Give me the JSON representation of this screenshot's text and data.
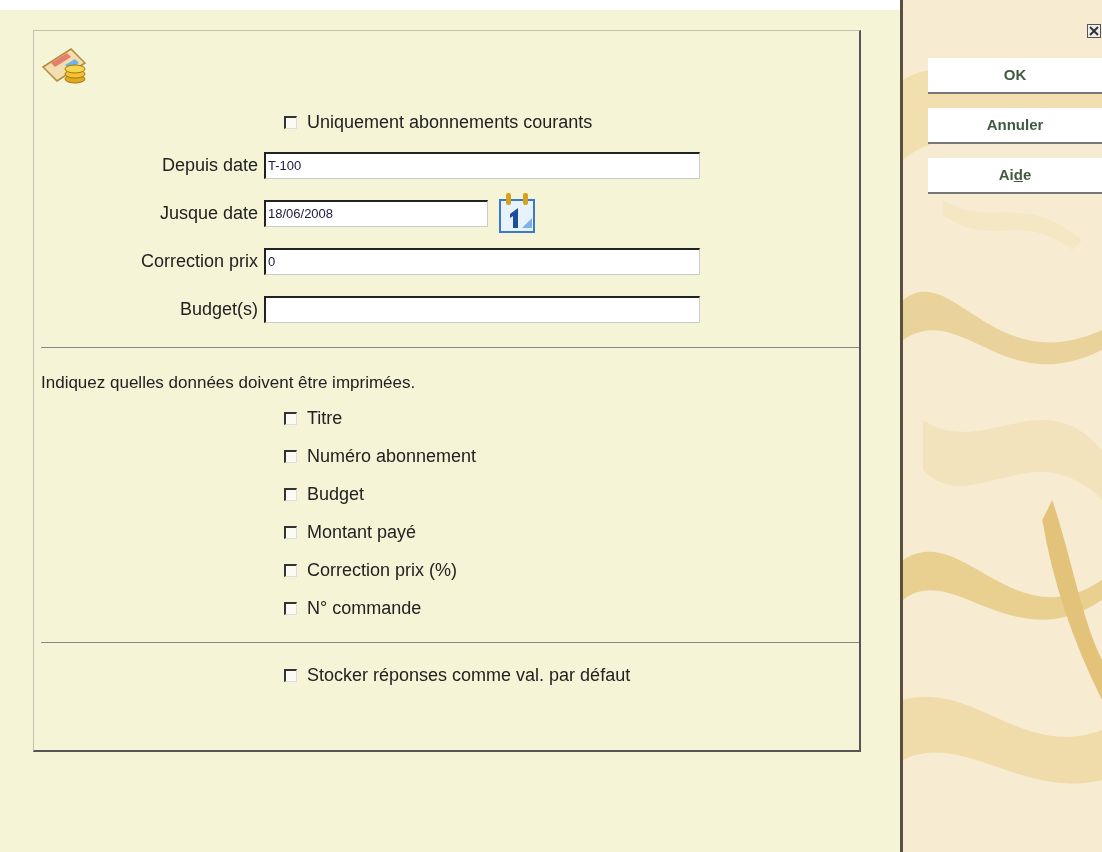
{
  "form": {
    "current_only": {
      "label": "Uniquement abonnements courants",
      "checked": false
    },
    "fields": [
      {
        "label": "Depuis date",
        "value": "T-100",
        "kind": "text"
      },
      {
        "label": "Jusque date",
        "value": "18/06/2008",
        "kind": "date"
      },
      {
        "label": "Correction prix",
        "value": "0",
        "kind": "text"
      },
      {
        "label": "Budget(s)",
        "kind": "text"
      }
    ],
    "print_prompt": "Indiquez quelles données doivent être imprimées.",
    "print_options": [
      {
        "label": "Titre",
        "checked": false
      },
      {
        "label": "Numéro abonnement",
        "checked": false
      },
      {
        "label": "Budget",
        "checked": false
      },
      {
        "label": "Montant payé",
        "checked": false
      },
      {
        "label": "Correction prix (%)",
        "checked": false
      },
      {
        "label": "N° commande",
        "checked": false
      }
    ],
    "store_defaults": {
      "label": "Stocker réponses comme val. par défaut",
      "checked": false
    }
  },
  "buttons": [
    {
      "label": "OK"
    },
    {
      "label": "Annuler"
    },
    {
      "label_before": "Ai",
      "accesskey": "d",
      "label_after": "e"
    }
  ]
}
